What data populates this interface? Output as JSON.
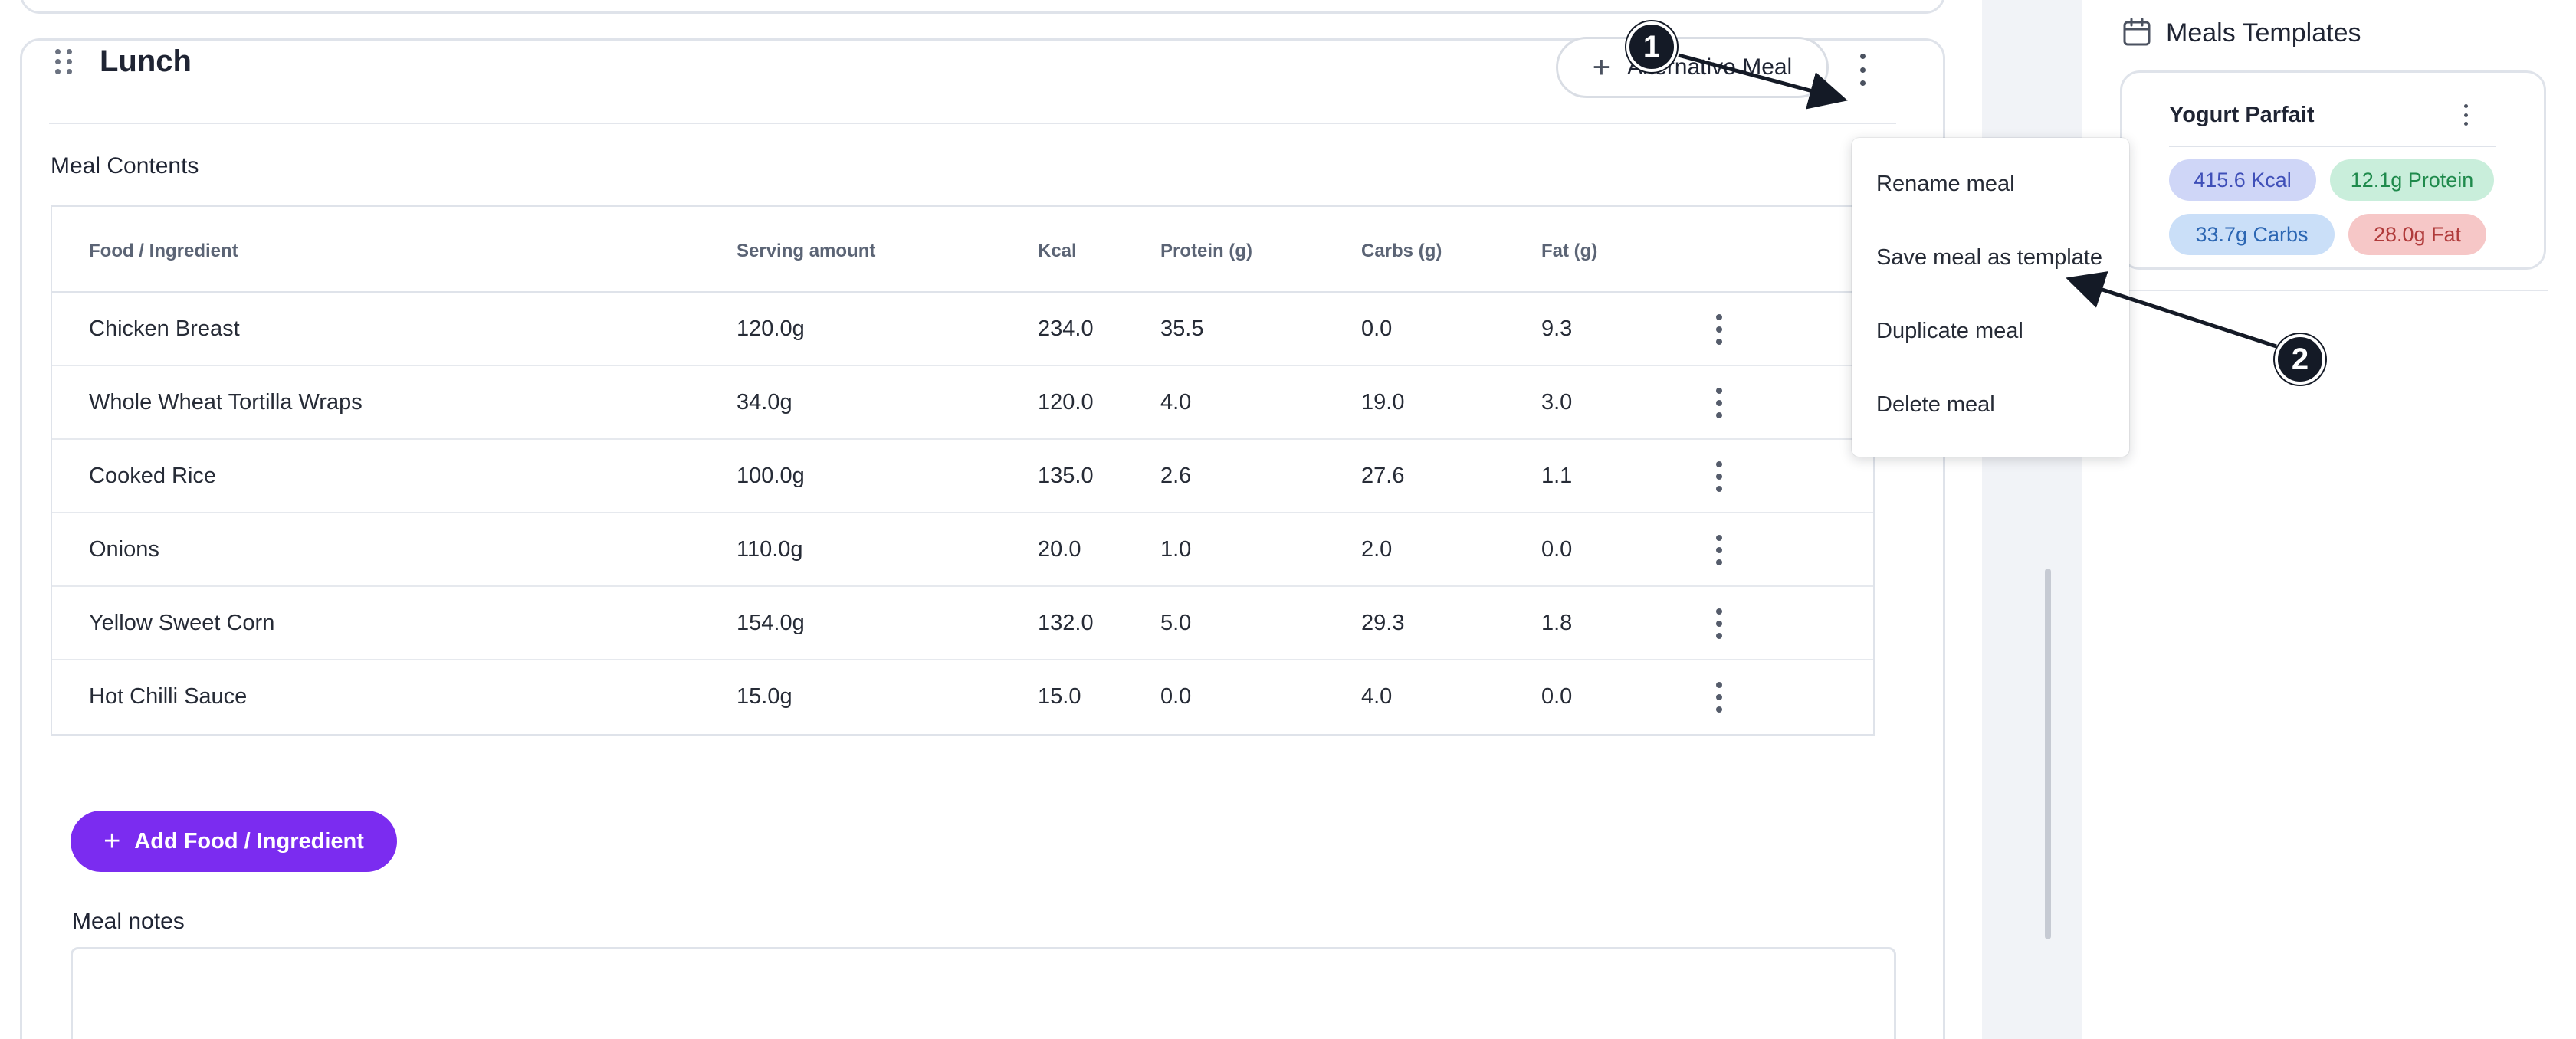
{
  "meal": {
    "title": "Lunch",
    "alt_button_label": "Alternative Meal",
    "contents_label": "Meal Contents",
    "add_button_label": "Add Food / Ingredient",
    "notes_label": "Meal notes"
  },
  "table": {
    "headers": [
      "Food / Ingredient",
      "Serving amount",
      "Kcal",
      "Protein (g)",
      "Carbs (g)",
      "Fat (g)"
    ],
    "rows": [
      {
        "food": "Chicken Breast",
        "serving": "120.0g",
        "kcal": "234.0",
        "protein": "35.5",
        "carbs": "0.0",
        "fat": "9.3"
      },
      {
        "food": "Whole Wheat Tortilla Wraps",
        "serving": "34.0g",
        "kcal": "120.0",
        "protein": "4.0",
        "carbs": "19.0",
        "fat": "3.0"
      },
      {
        "food": "Cooked Rice",
        "serving": "100.0g",
        "kcal": "135.0",
        "protein": "2.6",
        "carbs": "27.6",
        "fat": "1.1"
      },
      {
        "food": "Onions",
        "serving": "110.0g",
        "kcal": "20.0",
        "protein": "1.0",
        "carbs": "2.0",
        "fat": "0.0"
      },
      {
        "food": "Yellow Sweet Corn",
        "serving": "154.0g",
        "kcal": "132.0",
        "protein": "5.0",
        "carbs": "29.3",
        "fat": "1.8"
      },
      {
        "food": "Hot Chilli Sauce",
        "serving": "15.0g",
        "kcal": "15.0",
        "protein": "0.0",
        "carbs": "4.0",
        "fat": "0.0"
      }
    ]
  },
  "menu": {
    "items": [
      "Rename meal",
      "Save meal as template",
      "Duplicate meal",
      "Delete meal"
    ]
  },
  "templates": {
    "title": "Meals Templates",
    "card": {
      "name": "Yogurt Parfait",
      "kcal": "415.6 Kcal",
      "protein": "12.1g Protein",
      "carbs": "33.7g Carbs",
      "fat": "28.0g Fat"
    }
  },
  "callouts": [
    "1",
    "2"
  ],
  "colors": {
    "accent": "#7b2cf0",
    "kcal_pill": "#cfd6f7",
    "protein_pill": "#c9eedb",
    "carbs_pill": "#cadff8",
    "fat_pill": "#f6c7c7",
    "callout": "#141a26"
  }
}
